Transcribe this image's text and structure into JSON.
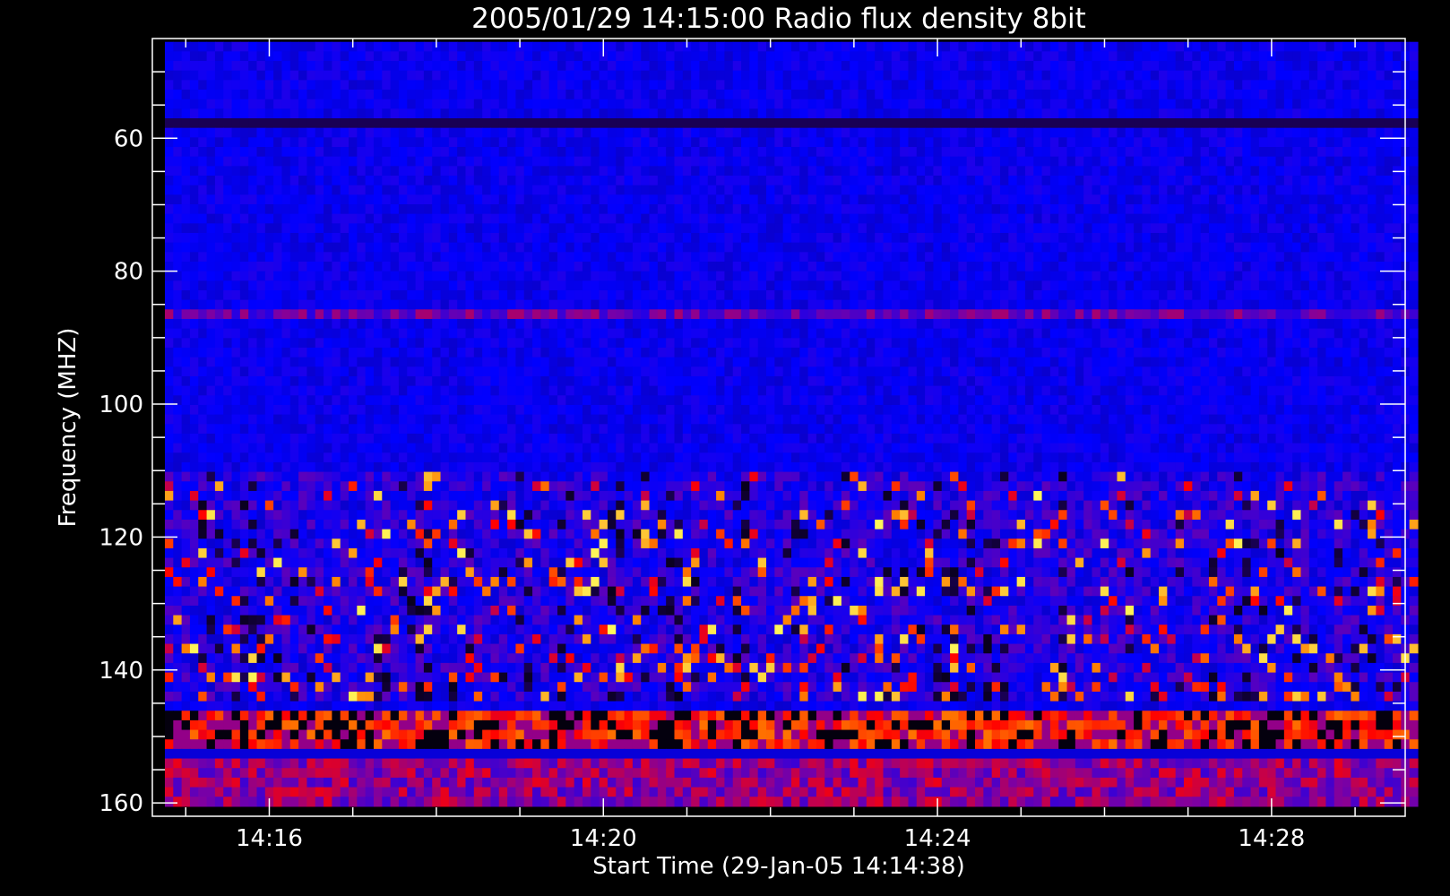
{
  "chart_data": {
    "type": "heatmap",
    "title": "2005/01/29 14:15:00 Radio flux density 8bit",
    "xlabel": "Start Time (29-Jan-05 14:14:38)",
    "ylabel": "Frequency (MHZ)",
    "x_range_minutes_after_1414": [
      0.6,
      15.6
    ],
    "y_range_mhz": [
      45,
      162
    ],
    "y_inverted": true,
    "x_ticks": [
      {
        "minute": 2,
        "label": "14:16"
      },
      {
        "minute": 6,
        "label": "14:20"
      },
      {
        "minute": 10,
        "label": "14:24"
      },
      {
        "minute": 14,
        "label": "14:28"
      }
    ],
    "y_ticks": [
      {
        "mhz": 60,
        "label": "60"
      },
      {
        "mhz": 80,
        "label": "80"
      },
      {
        "mhz": 100,
        "label": "100"
      },
      {
        "mhz": 120,
        "label": "120"
      },
      {
        "mhz": 140,
        "label": "140"
      },
      {
        "mhz": 160,
        "label": "160"
      }
    ],
    "data_extent": {
      "time_start_min": 0.75,
      "time_end_min": 15.75,
      "freq_low_mhz": 45.5,
      "freq_high_mhz": 160.5
    },
    "colormap": [
      "#000000",
      "#1e0064",
      "#0000ff",
      "#8000a0",
      "#ff0000",
      "#ff8000",
      "#ffff60",
      "#ffffff"
    ],
    "features": [
      {
        "name": "background",
        "freq_mhz": [
          45.5,
          160.5
        ],
        "level": 0.28
      },
      {
        "name": "interference-line",
        "freq_mhz": [
          57.5,
          58.3
        ],
        "level": 0.12
      },
      {
        "name": "interference-band",
        "freq_mhz": [
          85.5,
          87.5
        ],
        "level": 0.4
      },
      {
        "name": "burst-cluster",
        "freq_mhz": [
          110,
          145
        ],
        "level": 0.65
      },
      {
        "name": "strong-band",
        "freq_mhz": [
          146,
          152
        ],
        "level": 0.8
      },
      {
        "name": "quiet-gap",
        "freq_mhz": [
          152,
          153
        ],
        "level": 0.25
      },
      {
        "name": "low-band",
        "freq_mhz": [
          153,
          160.5
        ],
        "level": 0.45
      }
    ]
  }
}
